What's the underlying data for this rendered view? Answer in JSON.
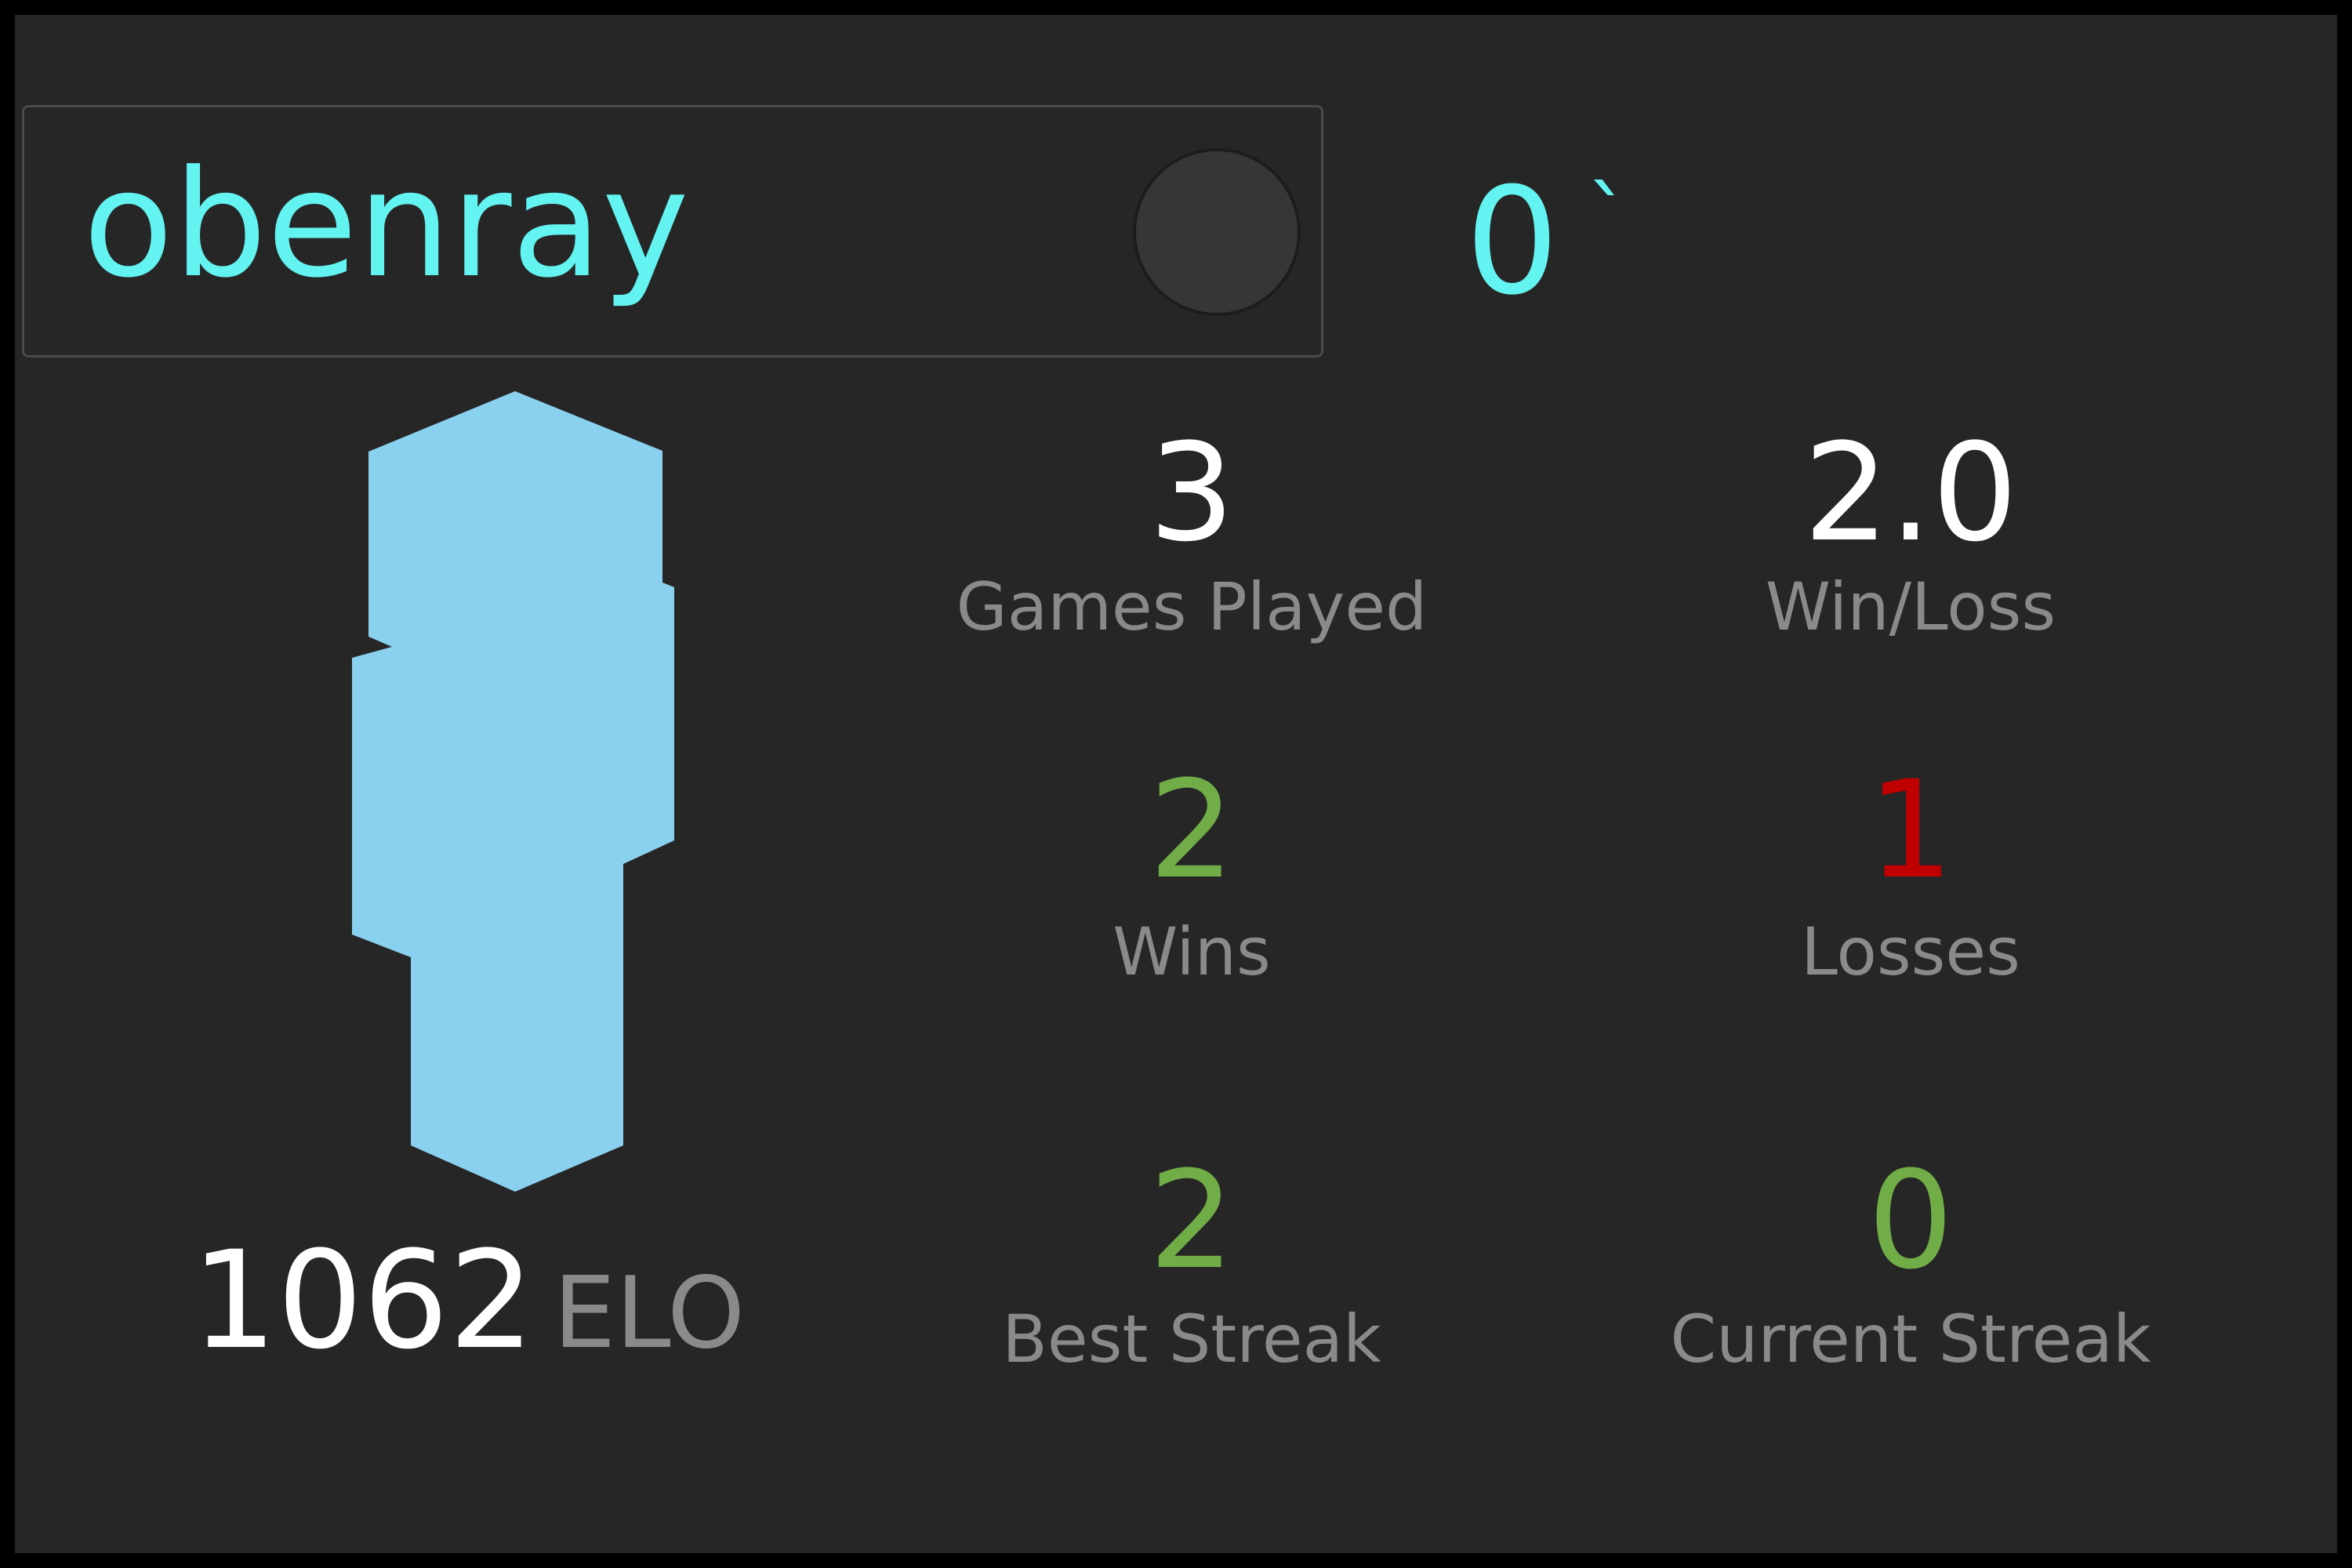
{
  "player": {
    "username": "obenray",
    "tag_value": "0",
    "tag_mark": "`",
    "elo_value": "1062",
    "elo_unit": "ELO",
    "avatar_color": "#8ad1f0",
    "online_indicator_color": "#363636"
  },
  "stats": {
    "games_played": {
      "value": "3",
      "label": "Games Played",
      "color": "#ffffff"
    },
    "win_loss": {
      "value": "2.0",
      "label": "Win/Loss",
      "color": "#ffffff"
    },
    "wins": {
      "value": "2",
      "label": "Wins",
      "color": "#70ad47"
    },
    "losses": {
      "value": "1",
      "label": "Losses",
      "color": "#c00000"
    },
    "best_streak": {
      "value": "2",
      "label": "Best Streak",
      "color": "#70ad47"
    },
    "current_streak": {
      "value": "0",
      "label": "Current Streak",
      "color": "#70ad47"
    }
  },
  "theme": {
    "background": "#262626",
    "accent": "#63f3f0",
    "muted_text": "#8a8a8a"
  }
}
